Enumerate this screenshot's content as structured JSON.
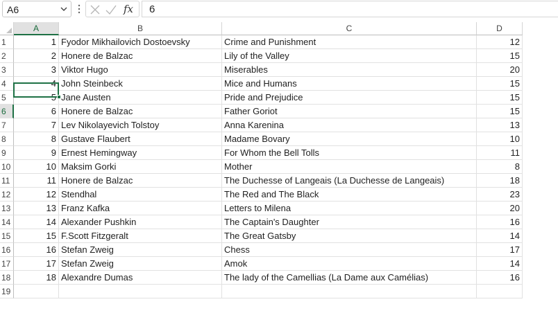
{
  "formula_bar": {
    "name_box": "A6",
    "fx_label": "fx",
    "formula_value": "6"
  },
  "columns": [
    "A",
    "B",
    "C",
    "D"
  ],
  "selected_column": "A",
  "selected_row": 6,
  "rows": [
    {
      "n": "1",
      "a": "1",
      "b": "Fyodor Mikhailovich Dostoevsky",
      "c": "Crime and Punishment",
      "d": "12"
    },
    {
      "n": "2",
      "a": "2",
      "b": "Honere de Balzac",
      "c": "Lily of the Valley",
      "d": "15"
    },
    {
      "n": "3",
      "a": "3",
      "b": "Viktor Hugo",
      "c": "Miserables",
      "d": "20"
    },
    {
      "n": "4",
      "a": "4",
      "b": "John Steinbeck",
      "c": "Mice and Humans",
      "d": "15"
    },
    {
      "n": "5",
      "a": "5",
      "b": "Jane Austen",
      "c": "Pride and Prejudice",
      "d": "15"
    },
    {
      "n": "6",
      "a": "6",
      "b": "Honere de Balzac",
      "c": "Father Goriot",
      "d": "15"
    },
    {
      "n": "7",
      "a": "7",
      "b": "Lev Nikolayevich Tolstoy",
      "c": "Anna Karenina",
      "d": "13"
    },
    {
      "n": "8",
      "a": "8",
      "b": "Gustave Flaubert",
      "c": "Madame Bovary",
      "d": "10"
    },
    {
      "n": "9",
      "a": "9",
      "b": "Ernest Hemingway",
      "c": "For Whom the Bell Tolls",
      "d": "11"
    },
    {
      "n": "10",
      "a": "10",
      "b": "Maksim Gorki",
      "c": "Mother",
      "d": "8"
    },
    {
      "n": "11",
      "a": "11",
      "b": "Honere de Balzac",
      "c": "The Duchesse of Langeais (La Duchesse de Langeais)",
      "d": "18"
    },
    {
      "n": "12",
      "a": "12",
      "b": "Stendhal",
      "c": "The Red and The Black",
      "d": "23"
    },
    {
      "n": "13",
      "a": "13",
      "b": "Franz Kafka",
      "c": "Letters to Milena",
      "d": "20"
    },
    {
      "n": "14",
      "a": "14",
      "b": "Alexander Pushkin",
      "c": "The Captain's Daughter",
      "d": "16"
    },
    {
      "n": "15",
      "a": "15",
      "b": "F.Scott Fitzgeralt",
      "c": "The Great Gatsby",
      "d": "14"
    },
    {
      "n": "16",
      "a": "16",
      "b": "Stefan Zweig",
      "c": "Chess",
      "d": "17"
    },
    {
      "n": "17",
      "a": "17",
      "b": "Stefan Zweig",
      "c": "Amok",
      "d": "14"
    },
    {
      "n": "18",
      "a": "18",
      "b": "Alexandre Dumas",
      "c": "The lady of the Camellias (La Dame aux Camélias)",
      "d": "16"
    },
    {
      "n": "19",
      "a": "",
      "b": "",
      "c": "",
      "d": ""
    }
  ],
  "colors": {
    "selection_green": "#1e7145",
    "header_selected_bg": "#e1e1e1",
    "gridline": "#e1e1e1"
  },
  "icons": {
    "name_box_dropdown": "chevron-down-icon",
    "cancel": "cancel-icon",
    "enter": "checkmark-icon",
    "function": "fx-icon"
  }
}
